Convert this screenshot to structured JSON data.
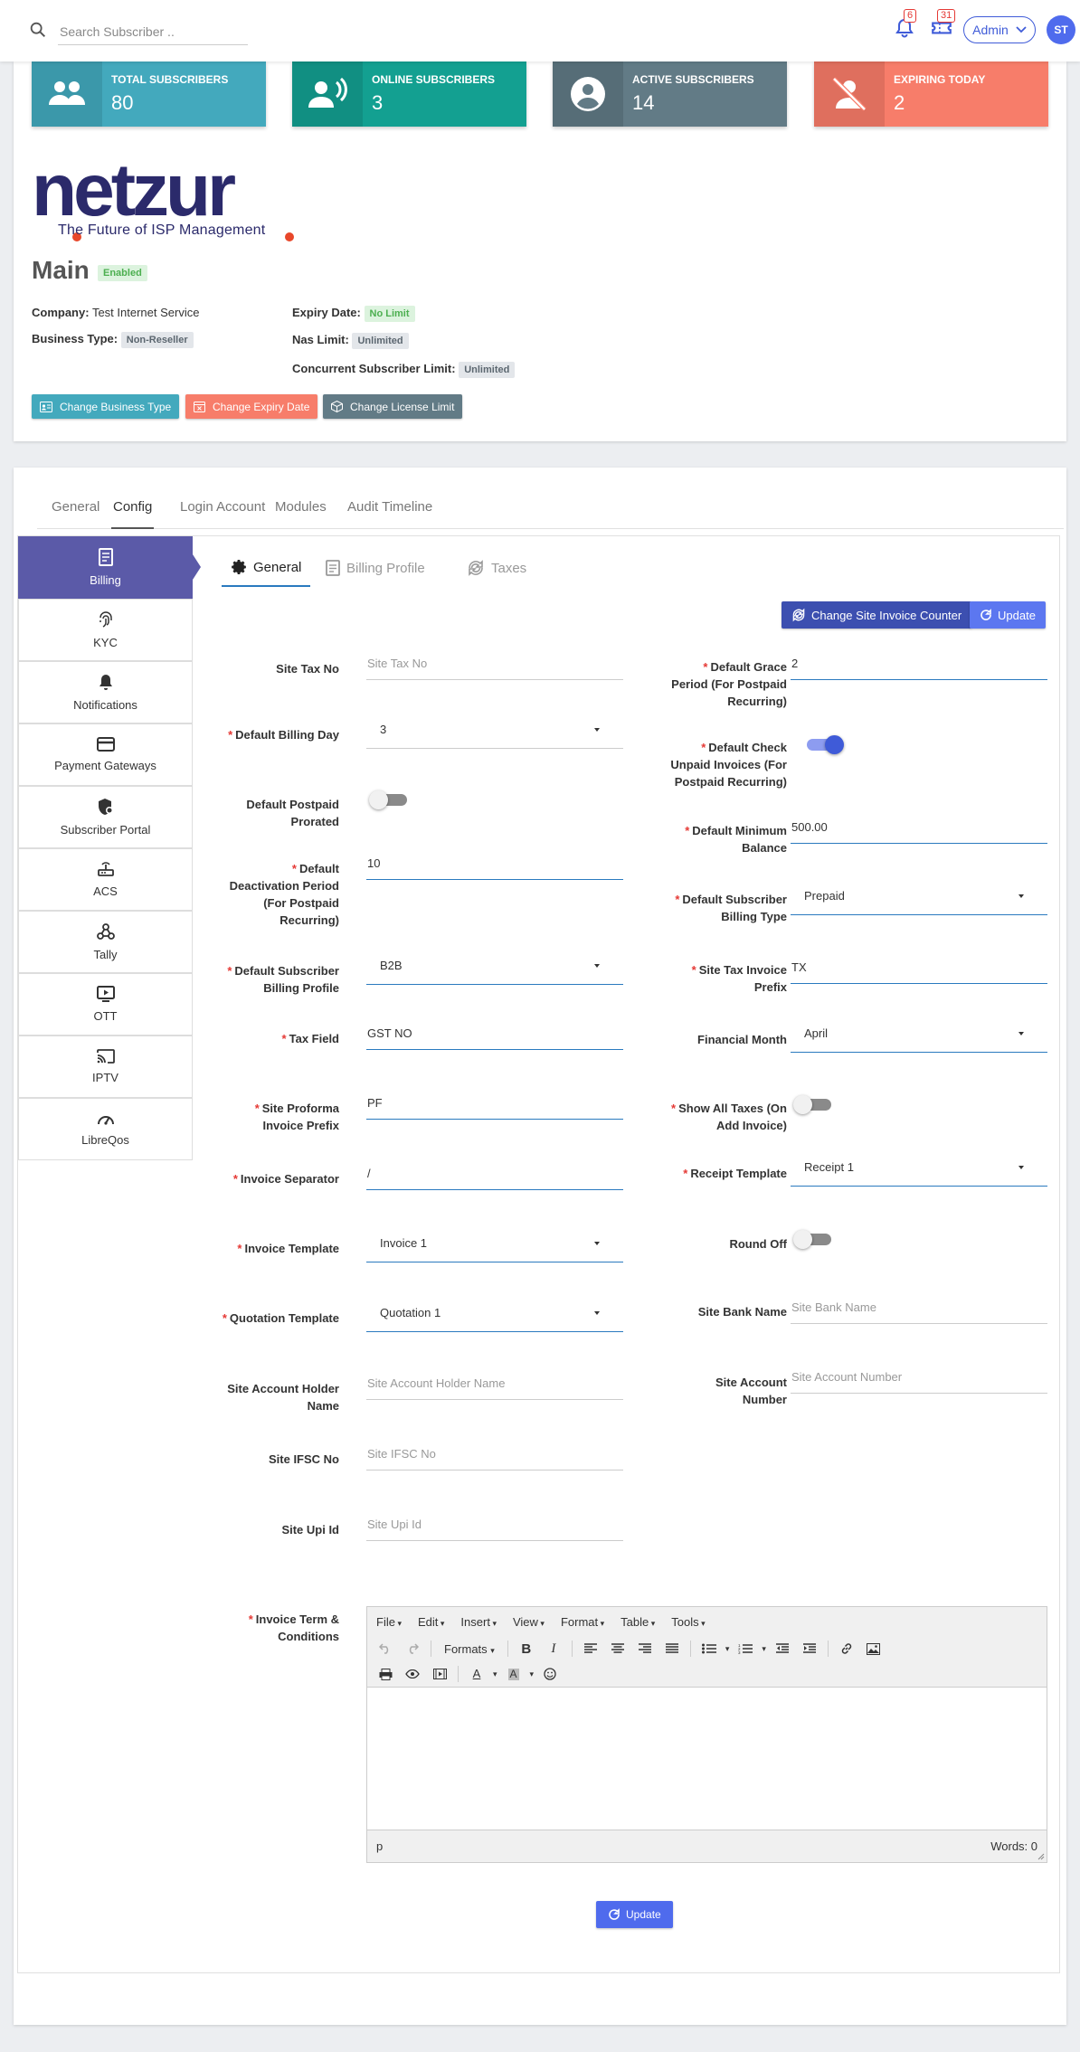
{
  "header": {
    "search_placeholder": "Search Subscriber ..",
    "notif_count": "6",
    "ticket_count": "31",
    "admin_label": "Admin",
    "avatar_initials": "ST"
  },
  "stats": [
    {
      "label": "TOTAL SUBSCRIBERS",
      "value": "80",
      "color": "#43a9bd",
      "icon_color": "#3b98aa",
      "icon": "users-icon"
    },
    {
      "label": "ONLINE SUBSCRIBERS",
      "value": "3",
      "color": "#13a091",
      "icon_color": "#118f82",
      "icon": "online-user-icon"
    },
    {
      "label": "ACTIVE SUBSCRIBERS",
      "value": "14",
      "color": "#627b86",
      "icon_color": "#566d77",
      "icon": "account-circle-icon"
    },
    {
      "label": "EXPIRING TODAY",
      "value": "2",
      "color": "#f77d6a",
      "icon_color": "#df6f5e",
      "icon": "user-off-icon"
    }
  ],
  "brand": {
    "logo_text": "netzur",
    "tagline": "The Future of ISP Management",
    "logo_color": "#2b2a6b",
    "dot_color": "#e8472a"
  },
  "site": {
    "name": "Main",
    "status": "Enabled",
    "company_label": "Company:",
    "company_value": "Test Internet Service",
    "business_type_label": "Business Type:",
    "business_type_value": "Non-Reseller",
    "expiry_label": "Expiry Date:",
    "expiry_value": "No Limit",
    "nas_label": "Nas Limit:",
    "nas_value": "Unlimited",
    "concurrent_label": "Concurrent Subscriber Limit:",
    "concurrent_value": "Unlimited"
  },
  "actions": {
    "change_business_type": "Change Business Type",
    "change_expiry_date": "Change Expiry Date",
    "change_license_limit": "Change License Limit"
  },
  "tabs": [
    "General",
    "Config",
    "Login Account",
    "Modules",
    "Audit Timeline"
  ],
  "active_tab": "Config",
  "sidebar": [
    {
      "label": "Billing",
      "icon": "billing-icon",
      "active": true
    },
    {
      "label": "KYC",
      "icon": "fingerprint-icon"
    },
    {
      "label": "Notifications",
      "icon": "bell-icon"
    },
    {
      "label": "Payment Gateways",
      "icon": "credit-card-icon"
    },
    {
      "label": "Subscriber Portal",
      "icon": "shield-icon"
    },
    {
      "label": "ACS",
      "icon": "router-icon"
    },
    {
      "label": "Tally",
      "icon": "webhook-icon"
    },
    {
      "label": "OTT",
      "icon": "play-box-icon"
    },
    {
      "label": "IPTV",
      "icon": "cast-icon"
    },
    {
      "label": "LibreQos",
      "icon": "speedometer-icon"
    }
  ],
  "subtabs": [
    "General",
    "Billing Profile",
    "Taxes"
  ],
  "buttons": {
    "change_invoice_counter": "Change Site Invoice Counter",
    "update": "Update"
  },
  "form": {
    "site_tax_no": {
      "label": "Site Tax No",
      "placeholder": "Site Tax No"
    },
    "grace_period": {
      "label": "Default Grace Period (For Postpaid Recurring)",
      "value": "2"
    },
    "billing_day": {
      "label": "Default Billing Day",
      "value": "3"
    },
    "check_unpaid": {
      "label": "Default Check Unpaid Invoices (For Postpaid Recurring)",
      "on": true
    },
    "postpaid_prorated": {
      "label": "Default Postpaid Prorated",
      "on": false
    },
    "minimum_balance": {
      "label": "Default Minimum Balance",
      "value": "500.00"
    },
    "deactivation_period": {
      "label": "Default Deactivation Period (For Postpaid Recurring)",
      "value": "10"
    },
    "billing_type": {
      "label": "Default Subscriber Billing Type",
      "value": "Prepaid"
    },
    "billing_profile": {
      "label": "Default Subscriber Billing Profile",
      "value": "B2B"
    },
    "tax_invoice_prefix": {
      "label": "Site Tax Invoice Prefix",
      "value": "TX"
    },
    "tax_field": {
      "label": "Tax Field",
      "value": "GST NO"
    },
    "financial_month": {
      "label": "Financial Month",
      "value": "April"
    },
    "proforma_prefix": {
      "label": "Site Proforma Invoice Prefix",
      "value": "PF"
    },
    "show_all_taxes": {
      "label": "Show All Taxes (On Add Invoice)",
      "on": false
    },
    "invoice_separator": {
      "label": "Invoice Separator",
      "value": "/"
    },
    "receipt_template": {
      "label": "Receipt Template",
      "value": "Receipt 1"
    },
    "invoice_template": {
      "label": "Invoice Template",
      "value": "Invoice 1"
    },
    "round_off": {
      "label": "Round Off",
      "on": false
    },
    "quotation_template": {
      "label": "Quotation Template",
      "value": "Quotation 1"
    },
    "bank_name": {
      "label": "Site Bank Name",
      "placeholder": "Site Bank Name"
    },
    "account_holder": {
      "label": "Site Account Holder Name",
      "placeholder": "Site Account Holder Name"
    },
    "account_number": {
      "label": "Site Account Number",
      "placeholder": "Site Account Number"
    },
    "ifsc": {
      "label": "Site IFSC No",
      "placeholder": "Site IFSC No"
    },
    "upi": {
      "label": "Site Upi Id",
      "placeholder": "Site Upi Id"
    },
    "terms": {
      "label": "Invoice Term & Conditions"
    }
  },
  "editor": {
    "menus": [
      "File",
      "Edit",
      "Insert",
      "View",
      "Format",
      "Table",
      "Tools"
    ],
    "formats_label": "Formats",
    "status_path": "p",
    "word_count": "Words: 0"
  }
}
